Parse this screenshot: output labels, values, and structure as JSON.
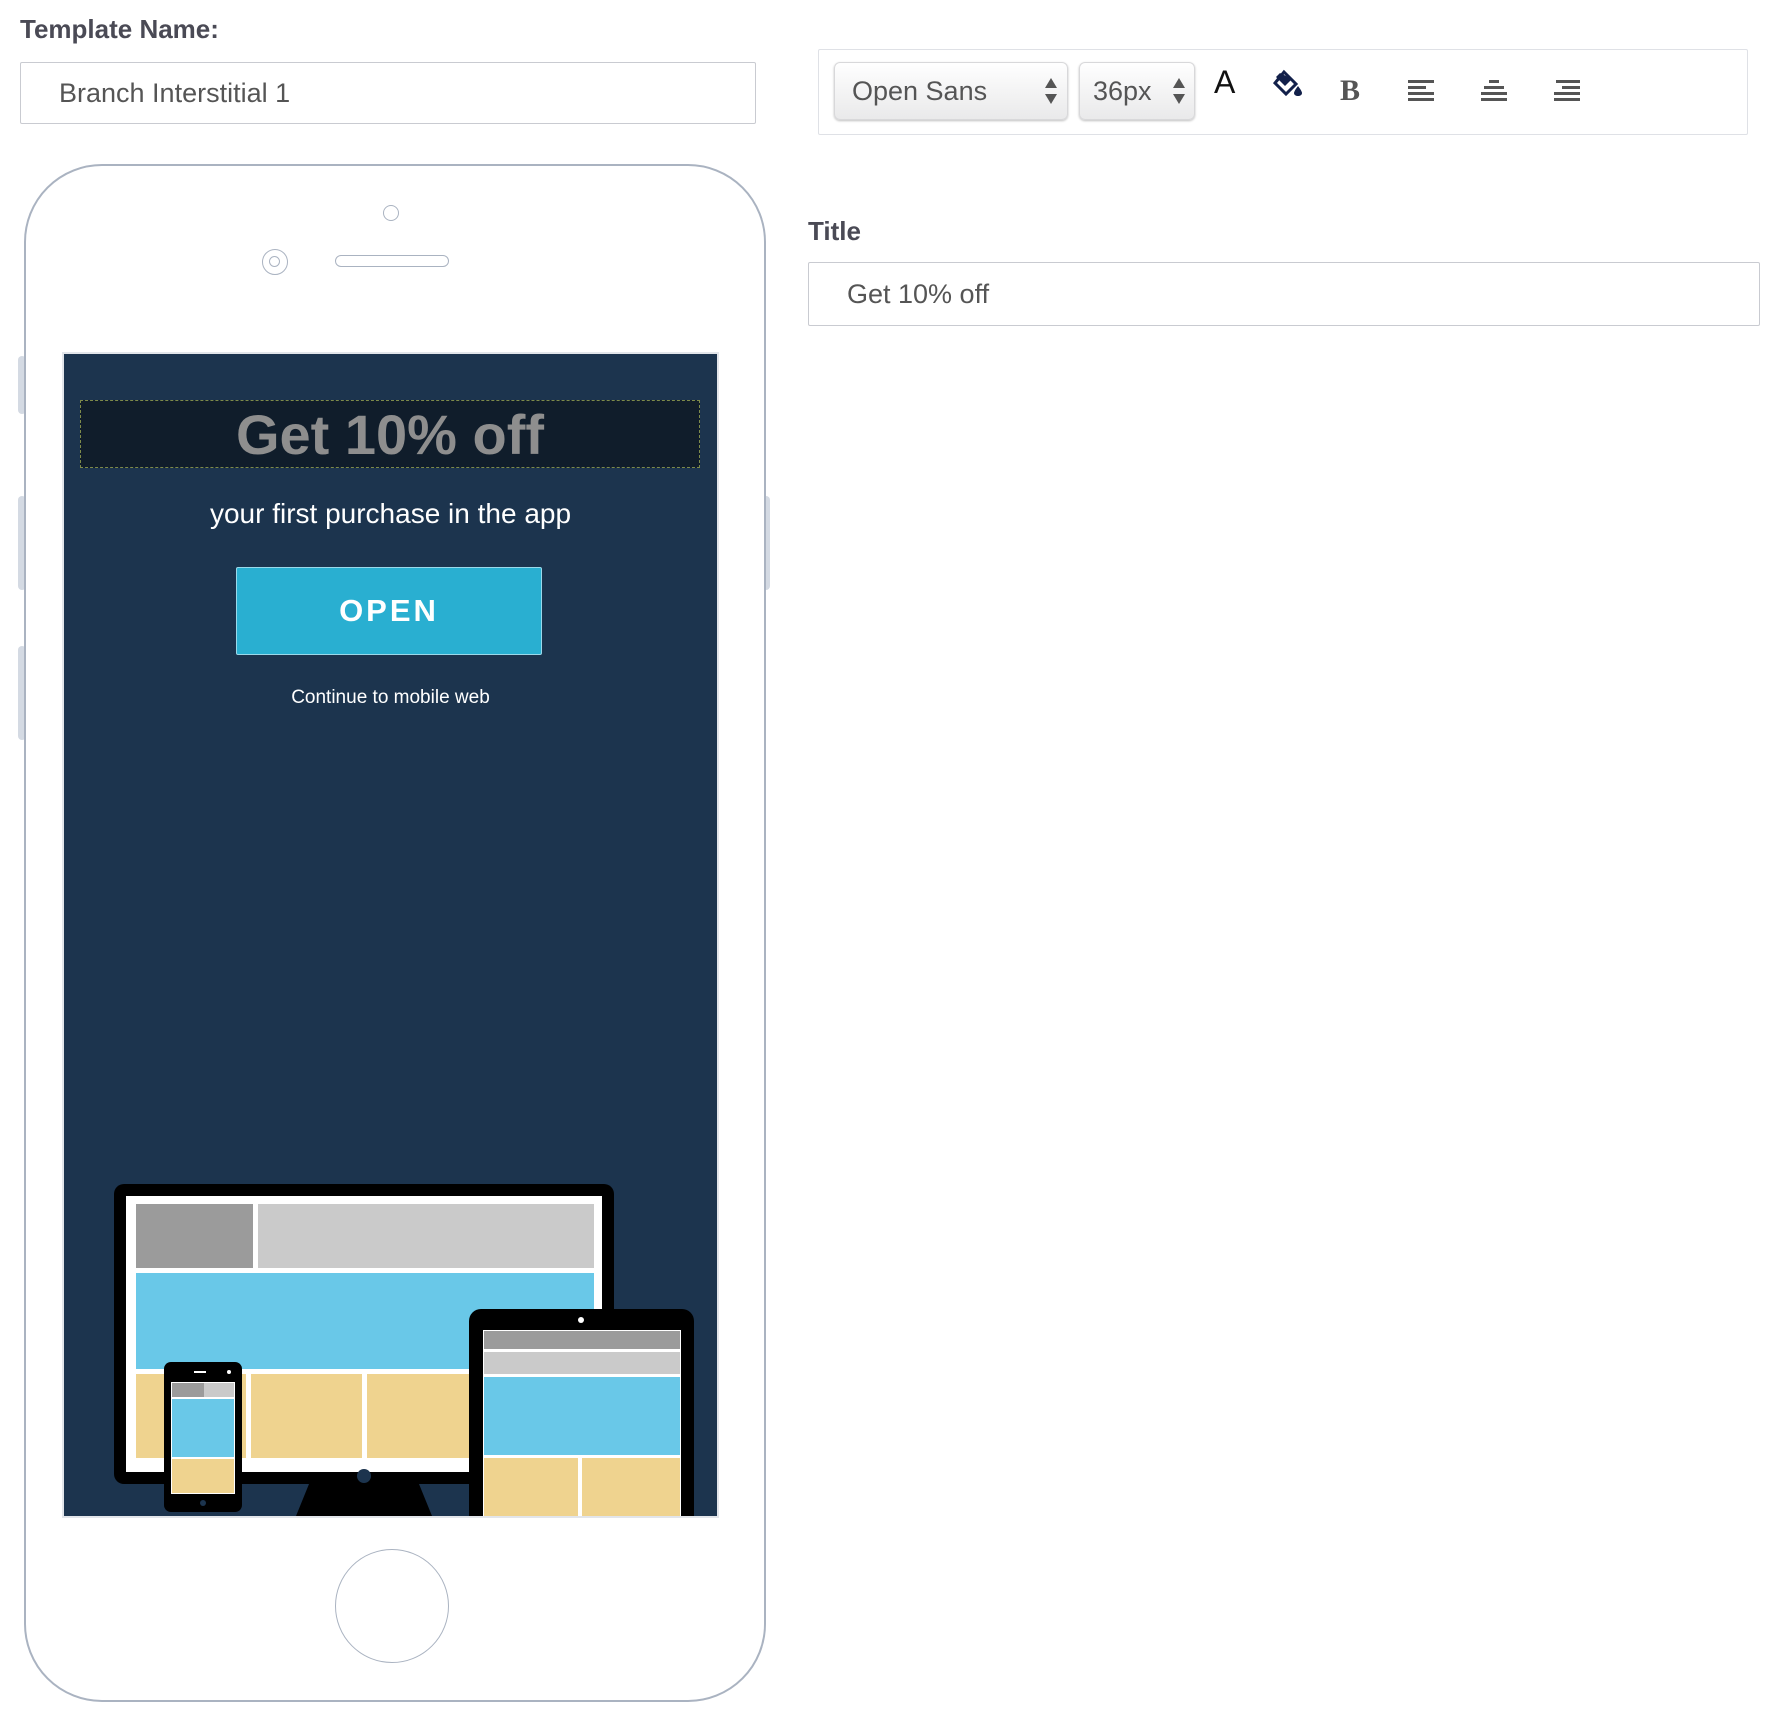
{
  "template_name": {
    "label": "Template Name:",
    "value": "Branch Interstitial 1"
  },
  "toolbar": {
    "font_family": "Open Sans",
    "font_size": "36px",
    "icons": [
      "text-color-icon",
      "fill-color-icon",
      "bold-icon",
      "align-left-icon",
      "align-center-icon",
      "align-right-icon"
    ],
    "bold_glyph": "B",
    "text_color_glyph": "A"
  },
  "title_field": {
    "label": "Title",
    "value": "Get 10% off"
  },
  "preview": {
    "title": "Get 10% off",
    "subtitle": "your first purchase in the app",
    "button_label": "OPEN",
    "continue_link": "Continue to mobile web"
  },
  "colors": {
    "screen_bg": "#1c344e",
    "title_bar_bg": "#101d2b",
    "button_bg": "#29afd1",
    "phone_outline": "#aab3c1",
    "illustration_blue": "#69c8e8",
    "illustration_tan": "#efd38f",
    "illustration_gray": "#cacaca",
    "illustration_dark_gray": "#9b9b9b"
  }
}
